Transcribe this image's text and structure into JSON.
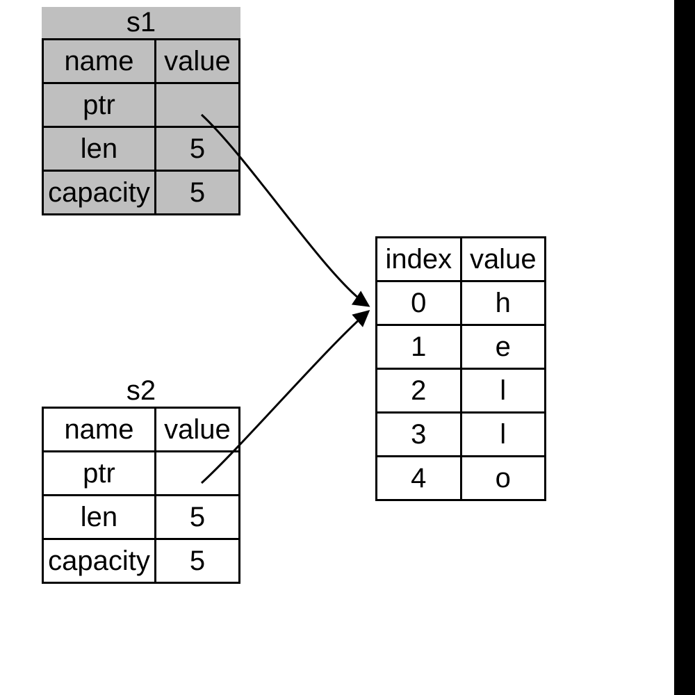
{
  "s1": {
    "title": "s1",
    "headers": {
      "name": "name",
      "value": "value"
    },
    "rows": [
      {
        "name": "ptr",
        "value": ""
      },
      {
        "name": "len",
        "value": "5"
      },
      {
        "name": "capacity",
        "value": "5"
      }
    ]
  },
  "s2": {
    "title": "s2",
    "headers": {
      "name": "name",
      "value": "value"
    },
    "rows": [
      {
        "name": "ptr",
        "value": ""
      },
      {
        "name": "len",
        "value": "5"
      },
      {
        "name": "capacity",
        "value": "5"
      }
    ]
  },
  "heap": {
    "headers": {
      "index": "index",
      "value": "value"
    },
    "rows": [
      {
        "index": "0",
        "value": "h"
      },
      {
        "index": "1",
        "value": "e"
      },
      {
        "index": "2",
        "value": "l"
      },
      {
        "index": "3",
        "value": "l"
      },
      {
        "index": "4",
        "value": "o"
      }
    ]
  }
}
